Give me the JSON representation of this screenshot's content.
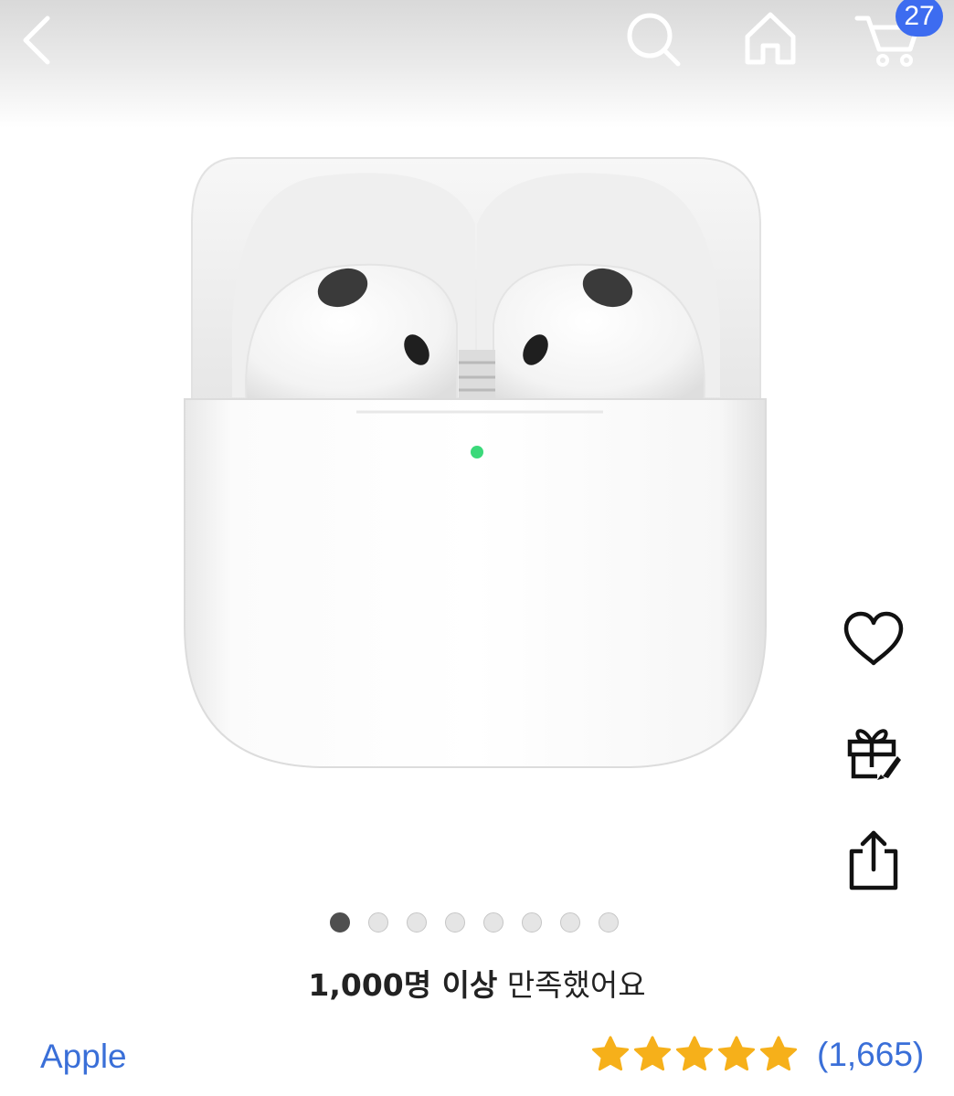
{
  "header": {
    "back_icon": "chevron-left-icon",
    "search_icon": "search-icon",
    "home_icon": "home-icon",
    "cart_icon": "cart-icon",
    "cart_count": "27",
    "badge_color": "#3d6cf0"
  },
  "product": {
    "image": "airpods-with-charging-case",
    "image_count": 8,
    "active_image": 1
  },
  "actions": {
    "wishlist_icon": "heart-icon",
    "gift_icon": "gift-rocket-icon",
    "share_icon": "share-icon"
  },
  "satisfaction": {
    "strong": "1,000명 이상",
    "rest": "만족했어요"
  },
  "brand": "Apple",
  "rating": {
    "stars": 5,
    "count": "(1,665)",
    "star_color": "#f6b01a"
  },
  "link_color": "#3a6fd8"
}
